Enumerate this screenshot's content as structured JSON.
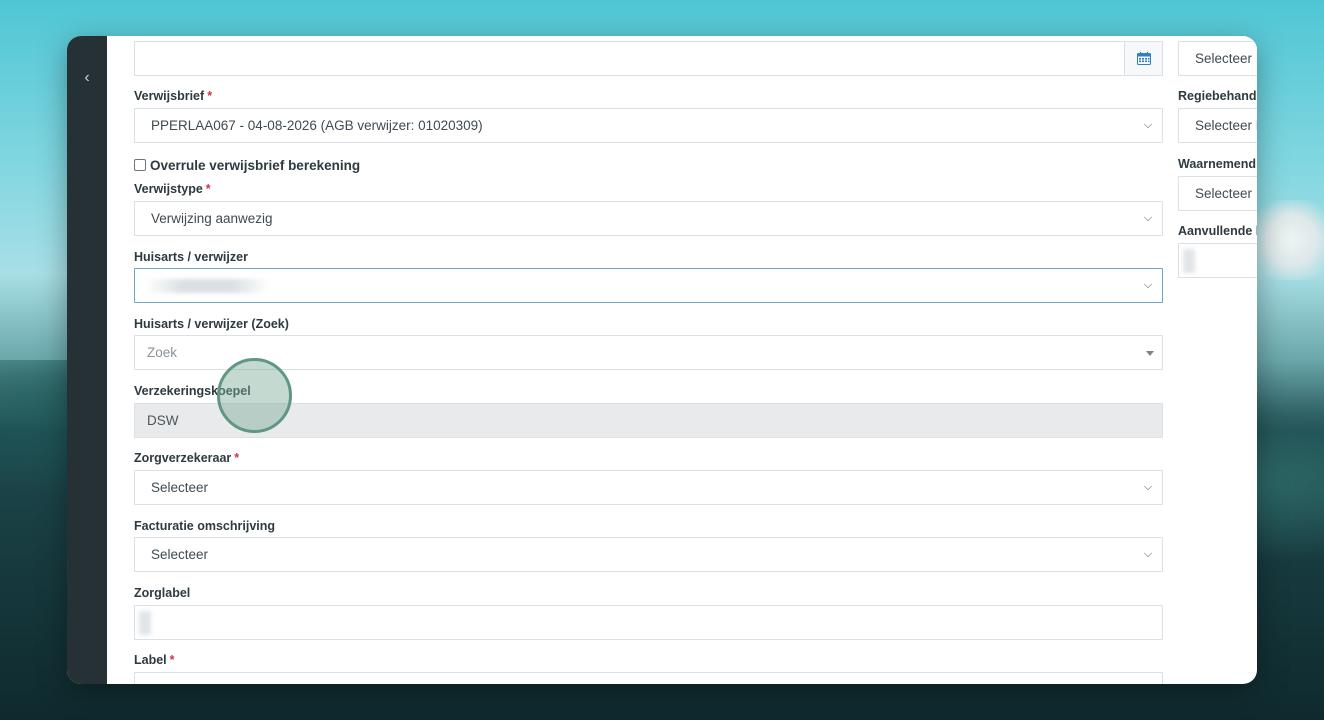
{
  "sidebar": {
    "toggle_icon": "‹"
  },
  "form": {
    "verwijsbrief": {
      "label": "Verwijsbrief",
      "required": "*",
      "value": "PPERLAA067 - 04-08-2026 (AGB verwijzer: 01020309)"
    },
    "overrule": {
      "label": "Overrule verwijsbrief berekening",
      "checked": false
    },
    "verwijstype": {
      "label": "Verwijstype",
      "required": "*",
      "value": "Verwijzing aanwezig"
    },
    "huisarts": {
      "label": "Huisarts / verwijzer",
      "value": ""
    },
    "huisarts_zoek": {
      "label": "Huisarts / verwijzer (Zoek)",
      "placeholder": "Zoek"
    },
    "verzekeringskoepel": {
      "label": "Verzekeringskoepel",
      "value": "DSW"
    },
    "zorgverzekeraar": {
      "label": "Zorgverzekeraar",
      "required": "*",
      "value": "Selecteer"
    },
    "facturatie": {
      "label": "Facturatie omschrijving",
      "value": "Selecteer"
    },
    "zorglabel": {
      "label": "Zorglabel",
      "value": ""
    },
    "label": {
      "label": "Label",
      "required": "*"
    }
  },
  "side": {
    "top_select": {
      "value": "Selecteer"
    },
    "regiebehandelaar": {
      "label": "Regiebehande",
      "value": "Selecteer E"
    },
    "waarnemend": {
      "label": "Waarnemend",
      "value": "Selecteer"
    },
    "aanvullende": {
      "label": "Aanvullende b"
    }
  },
  "colors": {
    "sidebar": "#263136",
    "required": "#d0324a",
    "focus_border": "#6ea7c2",
    "calendar_icon": "#2f7fbf"
  }
}
